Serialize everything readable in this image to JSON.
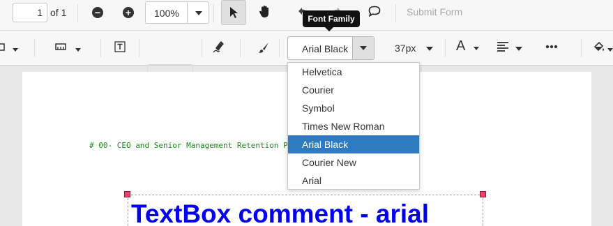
{
  "toolbar_top": {
    "page_number": "1",
    "page_total": "of 1",
    "zoom_value": "100%",
    "submit_form": "Submit Form",
    "tooltip": "Font Family"
  },
  "toolbar_annotation": {
    "font_family_value": "Arial Black",
    "font_size_value": "37px",
    "font_color_glyph": "A",
    "font_options": [
      "Helvetica",
      "Courier",
      "Symbol",
      "Times New Roman",
      "Arial Black",
      "Courier New",
      "Arial"
    ],
    "selected_option": "Arial Black"
  },
  "document": {
    "code_line": "# 00- CEO and Senior Management Retention P",
    "textbox_comment": "TextBox comment - arial"
  },
  "colors": {
    "accent_selected": "#2f7bbf",
    "textbox_text": "#0000ee",
    "code_text": "#1a8a1a",
    "handle": "#e8426a"
  },
  "icons": [
    "zoom-out-icon",
    "zoom-in-icon",
    "pointer-icon",
    "hand-pan-icon",
    "undo-icon",
    "redo-icon",
    "comment-icon",
    "shape-icon",
    "measure-icon",
    "free-text-icon",
    "stamp-icon",
    "signature-icon",
    "ink-brush-icon",
    "text-align-icon",
    "more-icon",
    "fill-color-icon"
  ]
}
